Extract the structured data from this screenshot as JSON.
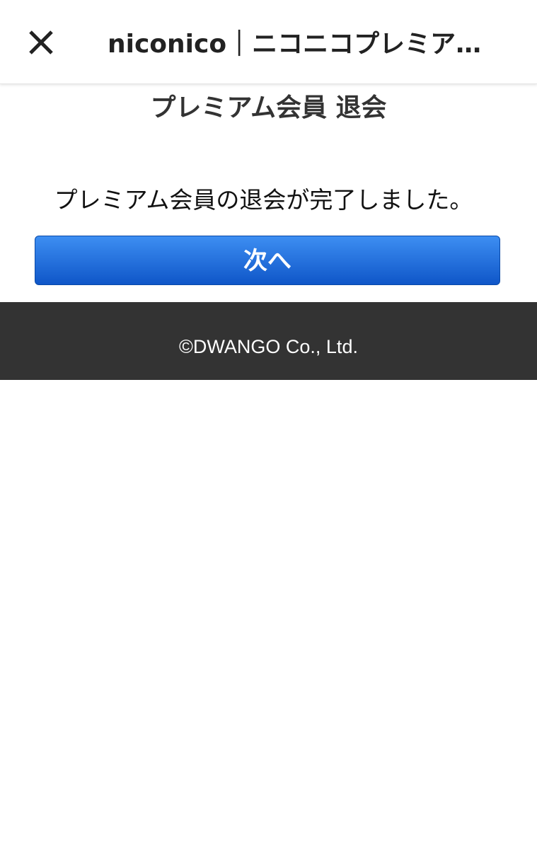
{
  "app_bar": {
    "close_icon": "close-icon",
    "title": "niconico｜ニコニコプレミア…"
  },
  "page": {
    "title": "プレミアム会員 退会",
    "message": "プレミアム会員の退会が完了しました。",
    "next_button_label": "次へ"
  },
  "footer": {
    "copyright": "©DWANGO Co., Ltd."
  },
  "colors": {
    "button_top": "#3d8ef2",
    "button_bottom": "#0f56c8",
    "footer_bg": "#333333"
  }
}
